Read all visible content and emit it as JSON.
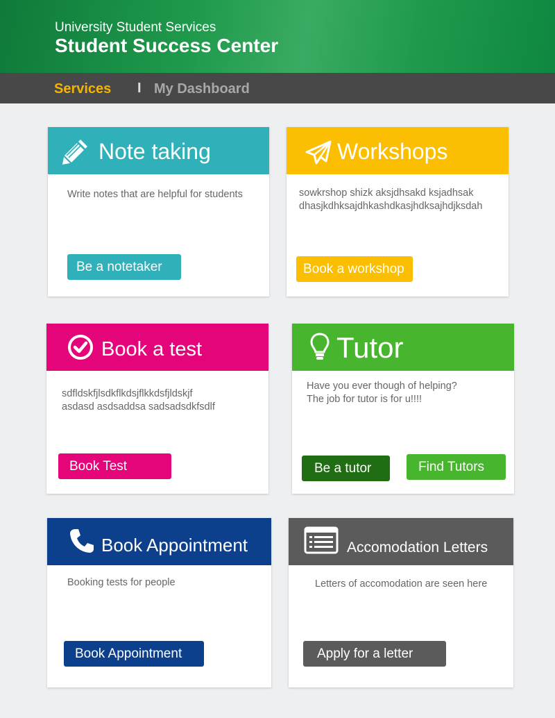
{
  "header": {
    "subtitle": "University Student Services",
    "title": "Student Success Center"
  },
  "nav": {
    "tabs": [
      {
        "label": "Services",
        "active": true
      },
      {
        "label": "My Dashboard",
        "active": false
      }
    ],
    "separator": "I"
  },
  "cards": [
    {
      "title": "Note taking",
      "icon": "pencil-icon",
      "color": "#30b0b8",
      "description": "Write notes that are helpful for students",
      "buttons": [
        {
          "label": "Be a notetaker",
          "color": "#30b0b8"
        }
      ]
    },
    {
      "title": "Workshops",
      "icon": "paper-plane-icon",
      "color": "#fbbe00",
      "description": "sowkrshop  shizk aksjdhsakd ksjadhsak\ndhasjkdhksajdhkashdkasjhdksajhdjksdah",
      "buttons": [
        {
          "label": "Book a workshop",
          "color": "#fbbe00"
        }
      ]
    },
    {
      "title": "Book a test",
      "icon": "check-circle-icon",
      "color": "#e5057a",
      "description": "sdfldskfjlsdkflkdsjflkkdsfjldskjf\nasdasd asdsaddsa sadsadsdkfsdlf",
      "buttons": [
        {
          "label": "Book Test",
          "color": "#e5057a"
        }
      ]
    },
    {
      "title": "Tutor",
      "icon": "lightbulb-icon",
      "color": "#47b52e",
      "description": "Have you ever though of helping?\nThe job for tutor is for u!!!!",
      "buttons": [
        {
          "label": "Be a tutor",
          "color": "#216d14"
        },
        {
          "label": "Find Tutors",
          "color": "#47b52e"
        }
      ]
    },
    {
      "title": "Book Appointment",
      "icon": "phone-icon",
      "color": "#0c3f8c",
      "description": "Booking tests for people",
      "buttons": [
        {
          "label": "Book Appointment",
          "color": "#0c3f8c"
        }
      ]
    },
    {
      "title": "Accomodation Letters",
      "icon": "letter-list-icon",
      "color": "#5b5b5b",
      "description": "Letters of accomodation are seen here",
      "buttons": [
        {
          "label": "Apply for a letter",
          "color": "#5b5b5b"
        }
      ]
    }
  ]
}
